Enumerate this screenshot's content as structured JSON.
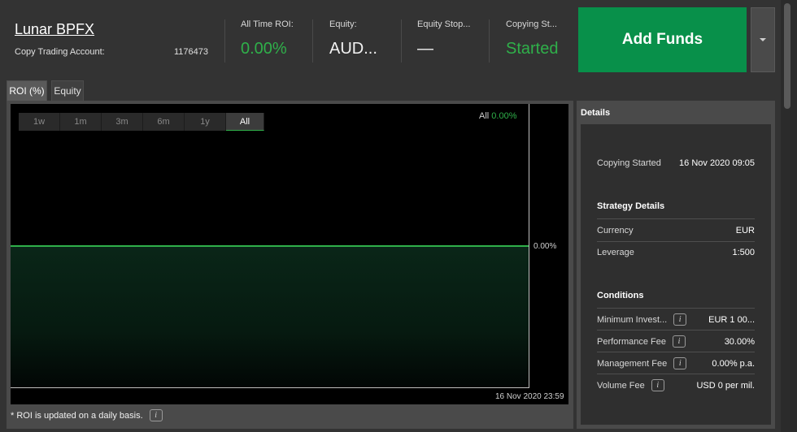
{
  "account": {
    "name": "Lunar BPFX",
    "label": "Copy Trading Account:",
    "number": "1176473"
  },
  "stats": {
    "roi_label": "All Time ROI:",
    "roi_value": "0.00%",
    "equity_label": "Equity:",
    "equity_value": "AUD...",
    "equity_stop_label": "Equity Stop...",
    "equity_stop_value": "—",
    "copying_label": "Copying St...",
    "copying_value": "Started"
  },
  "actions": {
    "add_funds": "Add Funds"
  },
  "tabs": [
    {
      "label": "ROI (%)",
      "active": true
    },
    {
      "label": "Equity",
      "active": false
    }
  ],
  "ranges": [
    {
      "label": "1w",
      "active": false
    },
    {
      "label": "1m",
      "active": false
    },
    {
      "label": "3m",
      "active": false
    },
    {
      "label": "6m",
      "active": false
    },
    {
      "label": "1y",
      "active": false
    },
    {
      "label": "All",
      "active": true
    }
  ],
  "chart_legend": {
    "label": "All",
    "value": "0.00%"
  },
  "chart_data": {
    "type": "area",
    "x": [
      "16 Nov 2020 23:59"
    ],
    "series": [
      {
        "values": [
          0.0
        ]
      }
    ],
    "yticks": [
      "0.00%"
    ],
    "xticks": [
      "16 Nov 2020 23:59"
    ],
    "color": "#2fb04a"
  },
  "footnote": "* ROI is updated on a daily basis.",
  "details": {
    "title": "Details",
    "copying_started_label": "Copying Started",
    "copying_started_value": "16 Nov 2020 09:05",
    "strategy_heading": "Strategy Details",
    "currency_label": "Currency",
    "currency_value": "EUR",
    "leverage_label": "Leverage",
    "leverage_value": "1:500",
    "conditions_heading": "Conditions",
    "min_invest_label": "Minimum Invest...",
    "min_invest_value": "EUR 1 00...",
    "perf_fee_label": "Performance Fee",
    "perf_fee_value": "30.00%",
    "mgmt_fee_label": "Management Fee",
    "mgmt_fee_value": "0.00% p.a.",
    "volume_fee_label": "Volume Fee",
    "volume_fee_value": "USD 0 per mil."
  },
  "info_icon": "i",
  "colors": {
    "accent_green": "#2fb04a",
    "button_green": "#08904a"
  }
}
